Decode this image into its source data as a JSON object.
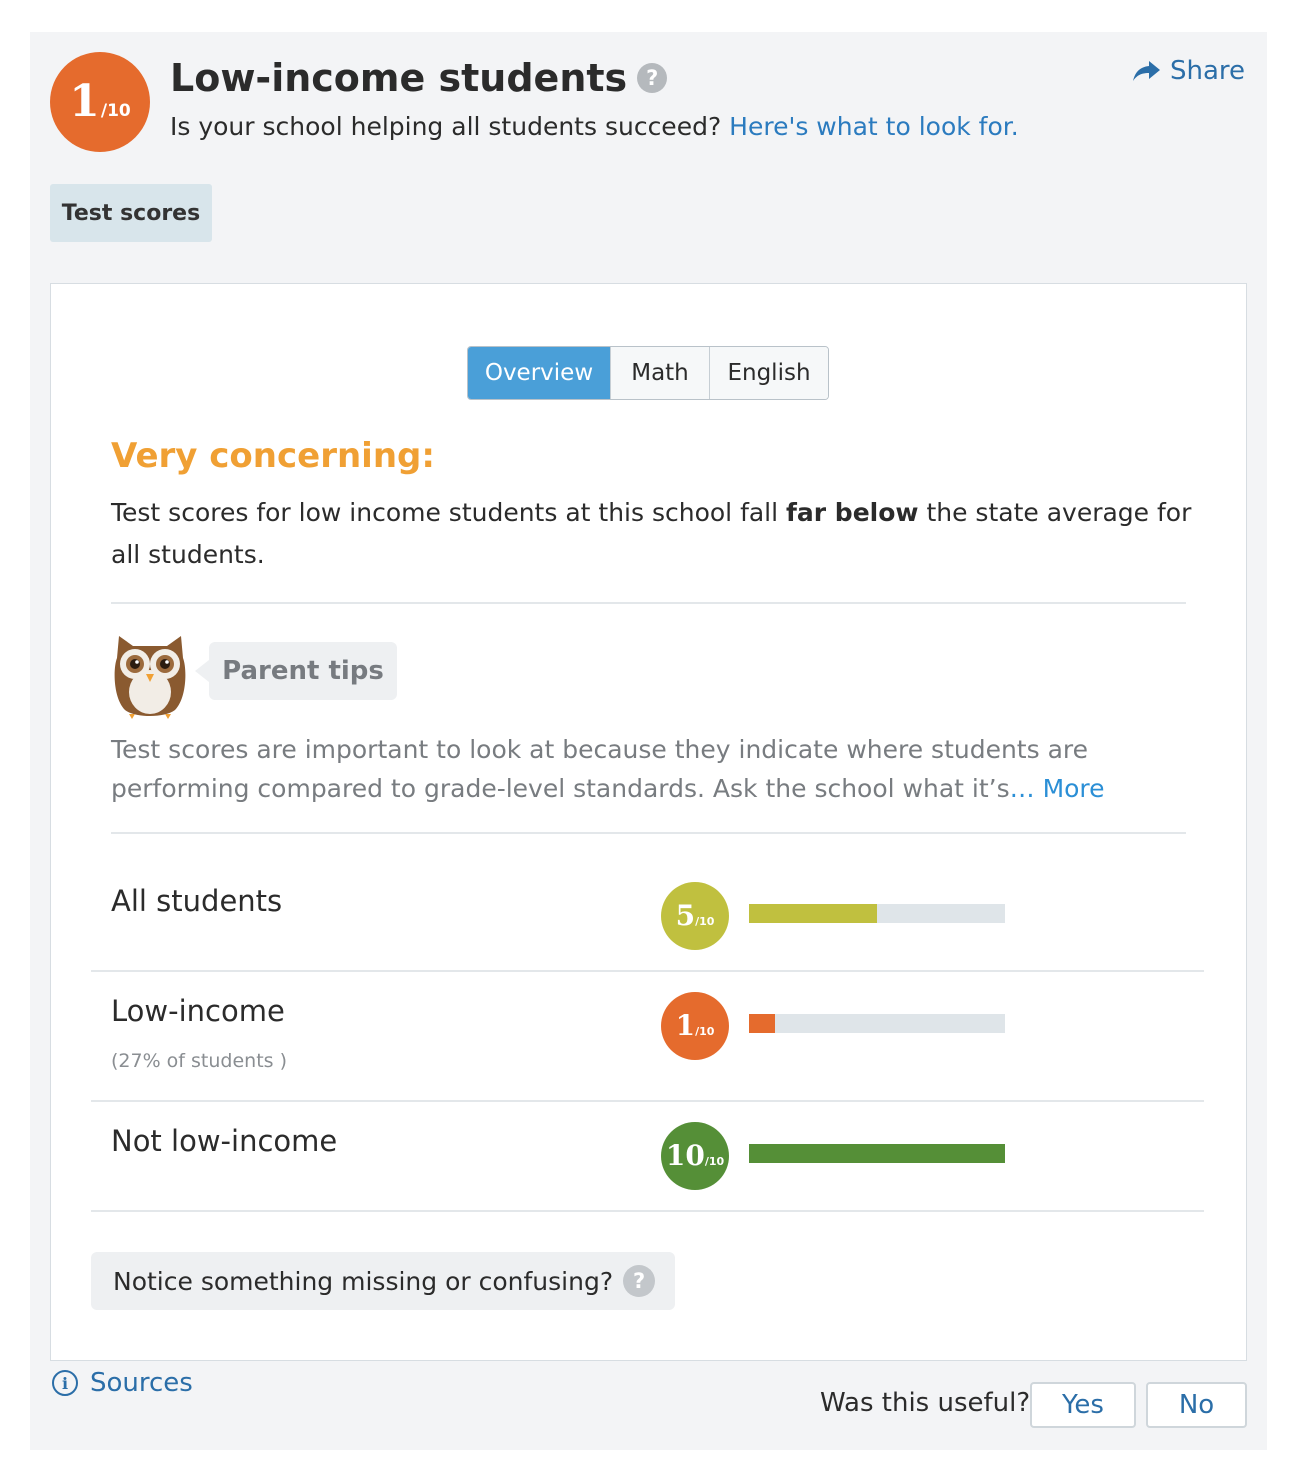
{
  "header": {
    "rating": "1",
    "rating_scale": "/10",
    "title": "Low-income students",
    "help_glyph": "?",
    "subtitle": "Is your school helping all students succeed?",
    "subtitle_link": "Here's what to look for.",
    "share_label": "Share"
  },
  "tag": "Test scores",
  "tabs": [
    "Overview",
    "Math",
    "English"
  ],
  "active_tab": "Overview",
  "summary": {
    "heading": "Very concerning:",
    "text_before": "Test scores for low income students at this school fall ",
    "text_bold": "far below",
    "text_after": " the state average for all students."
  },
  "parent_tips": {
    "label": "Parent tips",
    "text": "Test scores are important to look at because they indicate where students are performing compared to grade-level standards. Ask the school what it’s",
    "more_link": "… More"
  },
  "rows": [
    {
      "label": "All students",
      "sublabel": "",
      "rating": "5",
      "scale": "/10",
      "value": 5,
      "color": "#c0c03f"
    },
    {
      "label": "Low-income",
      "sublabel": "(27% of students )",
      "rating": "1",
      "scale": "/10",
      "value": 1,
      "color": "#e56b2d"
    },
    {
      "label": "Not low-income",
      "sublabel": "",
      "rating": "10",
      "scale": "/10",
      "value": 10,
      "color": "#558f37"
    }
  ],
  "notice": "Notice something missing or confusing?",
  "footer": {
    "sources_icon_glyph": "i",
    "sources_label": "Sources",
    "useful_label": "Was this useful?",
    "yes_label": "Yes",
    "no_label": "No"
  },
  "colors": {
    "accent_blue": "#4a9fd8",
    "link_blue": "#2b7bbf",
    "warning_orange": "#f0a034",
    "rating_low": "#e56b2d",
    "rating_mid": "#c0c03f",
    "rating_high": "#558f37"
  },
  "icons": [
    "help-icon",
    "share-arrow-icon",
    "owl-icon",
    "info-icon"
  ]
}
